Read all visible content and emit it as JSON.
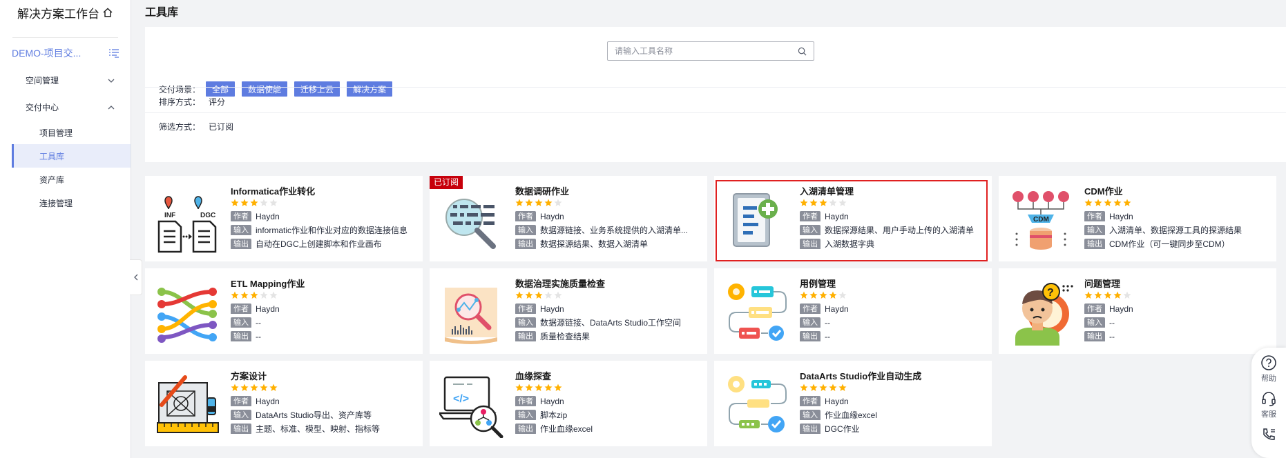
{
  "sidebar": {
    "app_title": "解决方案工作台",
    "project": "DEMO-项目交...",
    "groups": [
      {
        "label": "空间管理",
        "expanded": false
      },
      {
        "label": "交付中心",
        "expanded": true
      }
    ],
    "sub_items": [
      {
        "label": "项目管理",
        "active": false
      },
      {
        "label": "工具库",
        "active": true
      },
      {
        "label": "资产库",
        "active": false
      },
      {
        "label": "连接管理",
        "active": false
      }
    ]
  },
  "page": {
    "title": "工具库",
    "search_placeholder": "请输入工具名称"
  },
  "filters": {
    "scene_label": "交付场景：",
    "scene_tags": [
      "全部",
      "数据使能",
      "迁移上云",
      "解决方案"
    ],
    "sort_label": "排序方式：",
    "sort_value": "评分",
    "filter_label": "筛选方式：",
    "filter_value": "已订阅"
  },
  "meta_labels": {
    "author": "作者",
    "input": "输入",
    "output": "输出"
  },
  "subscribed_badge": "已订阅",
  "tools": [
    {
      "title": "Informatica作业转化",
      "rating": 3,
      "author": "Haydn",
      "input": "informatic作业和作业对应的数据连接信息",
      "output": "自动在DGC上创建脚本和作业画布",
      "icon": "document-convert-icon",
      "subscribed": false,
      "selected": false
    },
    {
      "title": "数据调研作业",
      "rating": 4,
      "author": "Haydn",
      "input": "数据源链接、业务系统提供的入湖清单...",
      "output": "数据探源结果、数据入湖清单",
      "icon": "data-search-icon",
      "subscribed": true,
      "selected": false
    },
    {
      "title": "入湖清单管理",
      "rating": 3,
      "author": "Haydn",
      "input": "数据探源结果、用户手动上传的入湖清单",
      "output": "入湖数据字典",
      "icon": "list-add-icon",
      "subscribed": false,
      "selected": true
    },
    {
      "title": "CDM作业",
      "rating": 5,
      "author": "Haydn",
      "input": "入湖清单、数据探源工具的探源结果",
      "output": "CDM作业（可一键同步至CDM）",
      "icon": "cdm-database-icon",
      "subscribed": false,
      "selected": false
    },
    {
      "title": "ETL Mapping作业",
      "rating": 3,
      "author": "Haydn",
      "input": "--",
      "output": "--",
      "icon": "etl-mapping-icon",
      "subscribed": false,
      "selected": false
    },
    {
      "title": "数据治理实施质量检查",
      "rating": 3,
      "author": "Haydn",
      "input": "数据源链接、DataArts Studio工作空间",
      "output": "质量检查结果",
      "icon": "quality-check-icon",
      "subscribed": false,
      "selected": false
    },
    {
      "title": "用例管理",
      "rating": 4,
      "author": "Haydn",
      "input": "--",
      "output": "--",
      "icon": "use-case-flow-icon",
      "subscribed": false,
      "selected": false
    },
    {
      "title": "问题管理",
      "rating": 4,
      "author": "Haydn",
      "input": "--",
      "output": "--",
      "icon": "problem-person-icon",
      "subscribed": false,
      "selected": false
    },
    {
      "title": "方案设计",
      "rating": 5,
      "author": "Haydn",
      "input": "DataArts Studio导出、资产库等",
      "output": "主题、标准、模型、映射、指标等",
      "icon": "design-blueprint-icon",
      "subscribed": false,
      "selected": false
    },
    {
      "title": "血缘探查",
      "rating": 5,
      "author": "Haydn",
      "input": "脚本zip",
      "output": "作业血缘excel",
      "icon": "lineage-search-icon",
      "subscribed": false,
      "selected": false
    },
    {
      "title": "DataArts Studio作业自动生成",
      "rating": 5,
      "author": "Haydn",
      "input": "作业血缘excel",
      "output": "DGC作业",
      "icon": "auto-generate-flow-icon",
      "subscribed": false,
      "selected": false
    }
  ],
  "float_tools": [
    {
      "label": "帮助",
      "icon": "help-icon"
    },
    {
      "label": "客服",
      "icon": "headset-icon"
    },
    {
      "label": "",
      "icon": "phone-icon"
    }
  ],
  "colors": {
    "accent": "#5e7ce0",
    "star": "#ffb000",
    "star_empty": "#e4e4e4",
    "badge": "#c7000b",
    "selected_border": "#e02020"
  }
}
